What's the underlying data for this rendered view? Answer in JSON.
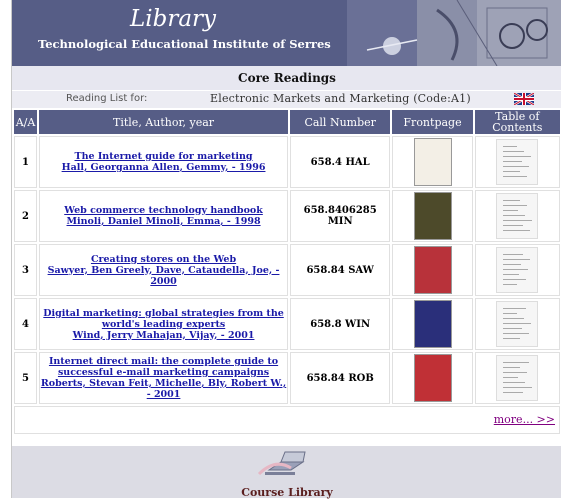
{
  "header": {
    "title": "Library",
    "subtitle": "Technological Educational Institute of Serres"
  },
  "section_title": "Core Readings",
  "reading_list": {
    "label": "Reading List for:",
    "course": "Electronic Markets and Marketing (Code:A1)",
    "flag_icon": "uk-flag-icon"
  },
  "table": {
    "headers": {
      "index": "A/A",
      "title": "Title, Author, year",
      "call": "Call Number",
      "front": "Frontpage",
      "toc": "Table of Contents"
    },
    "rows": [
      {
        "num": "1",
        "title": "The Internet guide for marketing",
        "authors": "Hall, Georganna Allen, Gemmy, - 1996",
        "call": "658.4 HAL",
        "cover_color": "#f3efe6"
      },
      {
        "num": "2",
        "title": "Web commerce technology handbook",
        "authors": "Minoli, Daniel Minoli, Emma, - 1998",
        "call": "658.8406285 MIN",
        "cover_color": "#4d4a2a"
      },
      {
        "num": "3",
        "title": "Creating stores on the Web",
        "authors": "Sawyer, Ben Greely, Dave, Cataudella, Joe, - 2000",
        "call": "658.84 SAW",
        "cover_color": "#b8323a"
      },
      {
        "num": "4",
        "title": "Digital marketing: global strategies from the world's leading experts",
        "authors": "Wind, Jerry Mahajan, Vijay, - 2001",
        "call": "658.8 WIN",
        "cover_color": "#2a2f7a"
      },
      {
        "num": "5",
        "title": "Internet direct mail: the complete guide to successful e-mail marketing campaigns",
        "authors": "Roberts, Stevan Feit, Michelle, Bly, Robert W., - 2001",
        "call": "658.84 ROB",
        "cover_color": "#c03036"
      }
    ]
  },
  "more_link": "more... >>",
  "footer": {
    "label": "Course Library"
  },
  "colors": {
    "header_bg": "#565d86",
    "link": "#1a1aa8",
    "visited_link": "#800080"
  }
}
